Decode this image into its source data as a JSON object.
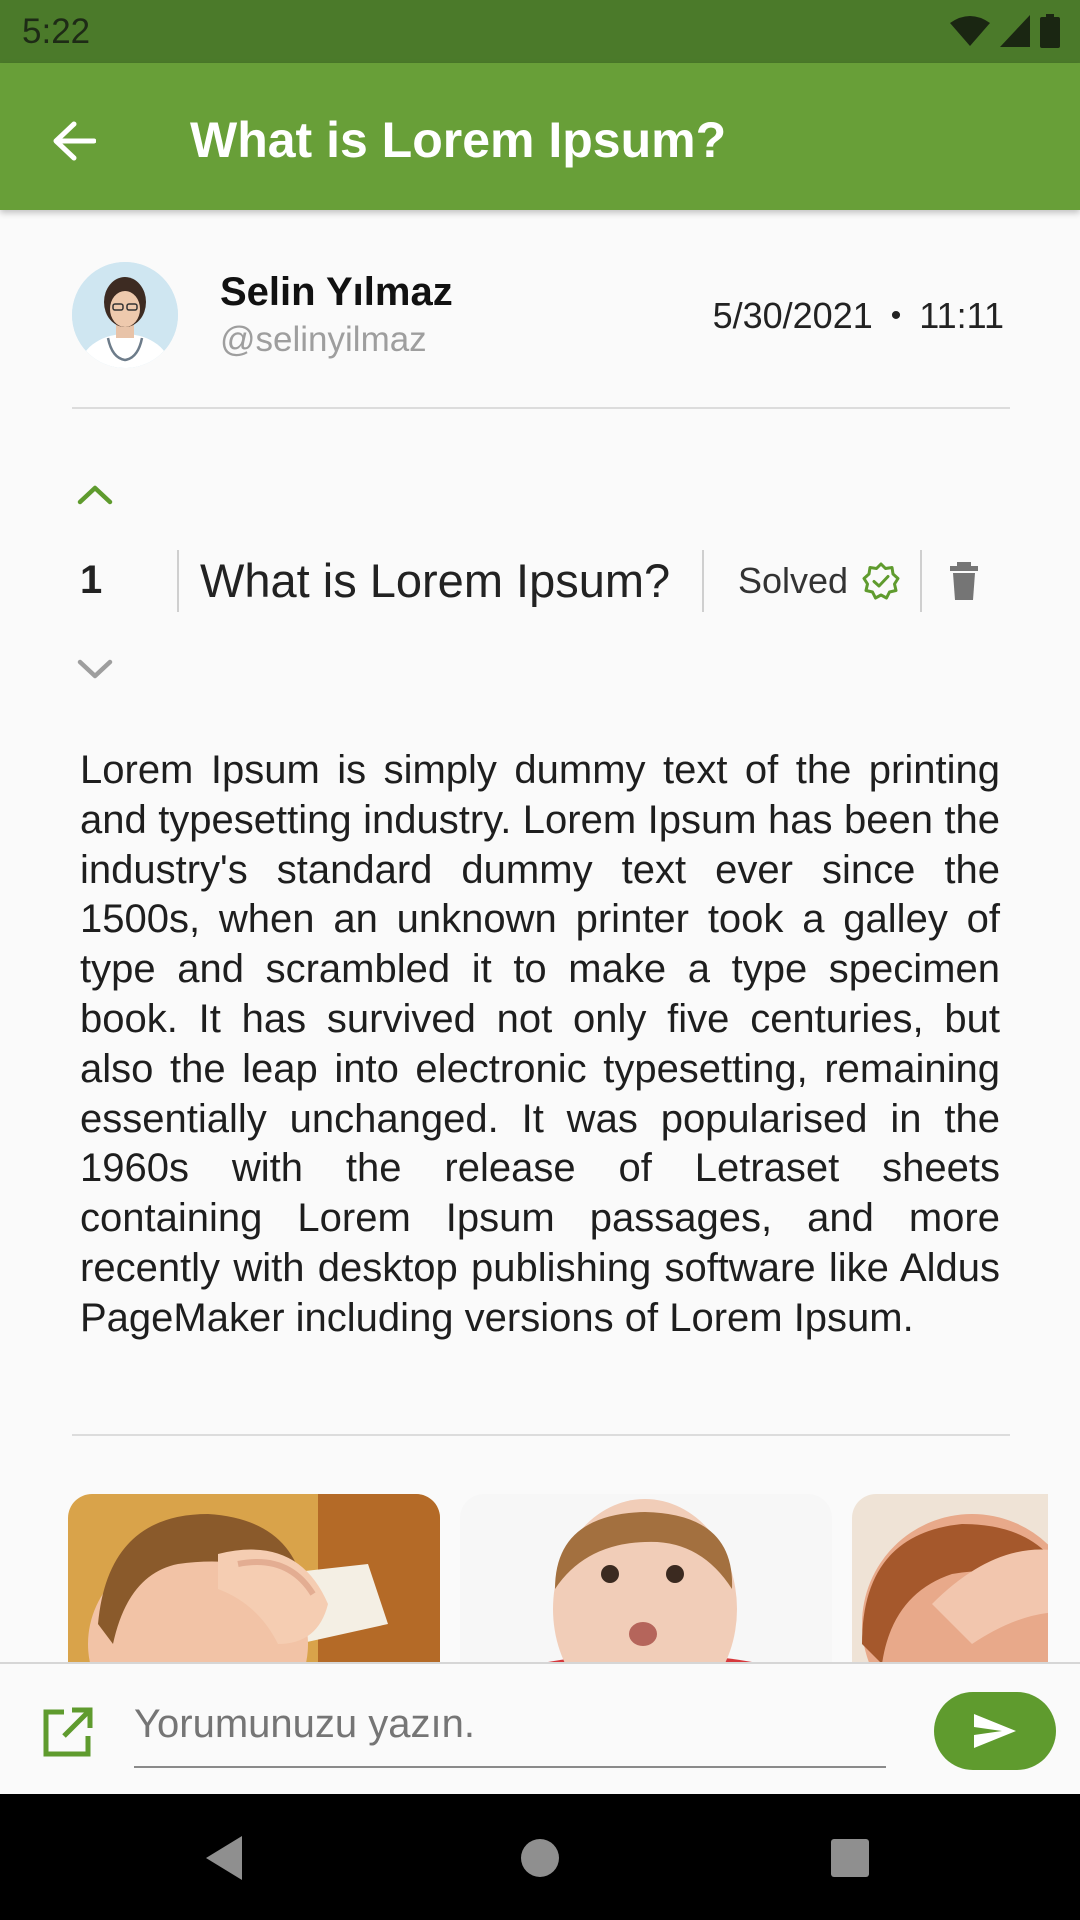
{
  "status_bar": {
    "time": "5:22",
    "icons": [
      "wifi-icon",
      "signal-icon",
      "battery-icon"
    ]
  },
  "app_bar": {
    "title": "What is Lorem Ipsum?",
    "back_icon": "arrow-back-icon"
  },
  "author": {
    "name": "Selin Yılmaz",
    "handle": "@selinyilmaz",
    "date": "5/30/2021",
    "separator": "•",
    "time": "11:11"
  },
  "question": {
    "vote_count": "1",
    "title": "What is Lorem Ipsum?",
    "status_label": "Solved",
    "status_icon": "verified-badge-icon",
    "delete_icon": "trash-icon",
    "body": "Lorem Ipsum is simply dummy text of the printing and typesetting industry. Lorem Ipsum has been the industry's standard dummy text ever since the 1500s, when an unknown printer took a galley of type and scrambled it to make a type specimen book. It has survived not only five centuries, but also the leap into electronic typesetting, remaining essentially unchanged. It was popularised in the 1960s with the release of Letraset sheets containing Lorem Ipsum passages, and more recently with desktop publishing software like Aldus PageMaker including versions of Lorem Ipsum."
  },
  "comment": {
    "placeholder": "Yorumunuzu yazın.",
    "attach_icon": "open-in-new-icon",
    "send_icon": "send-icon"
  },
  "colors": {
    "primary": "#689f38",
    "status_bar": "#4b7a2a",
    "accent": "#5f9b2e"
  }
}
